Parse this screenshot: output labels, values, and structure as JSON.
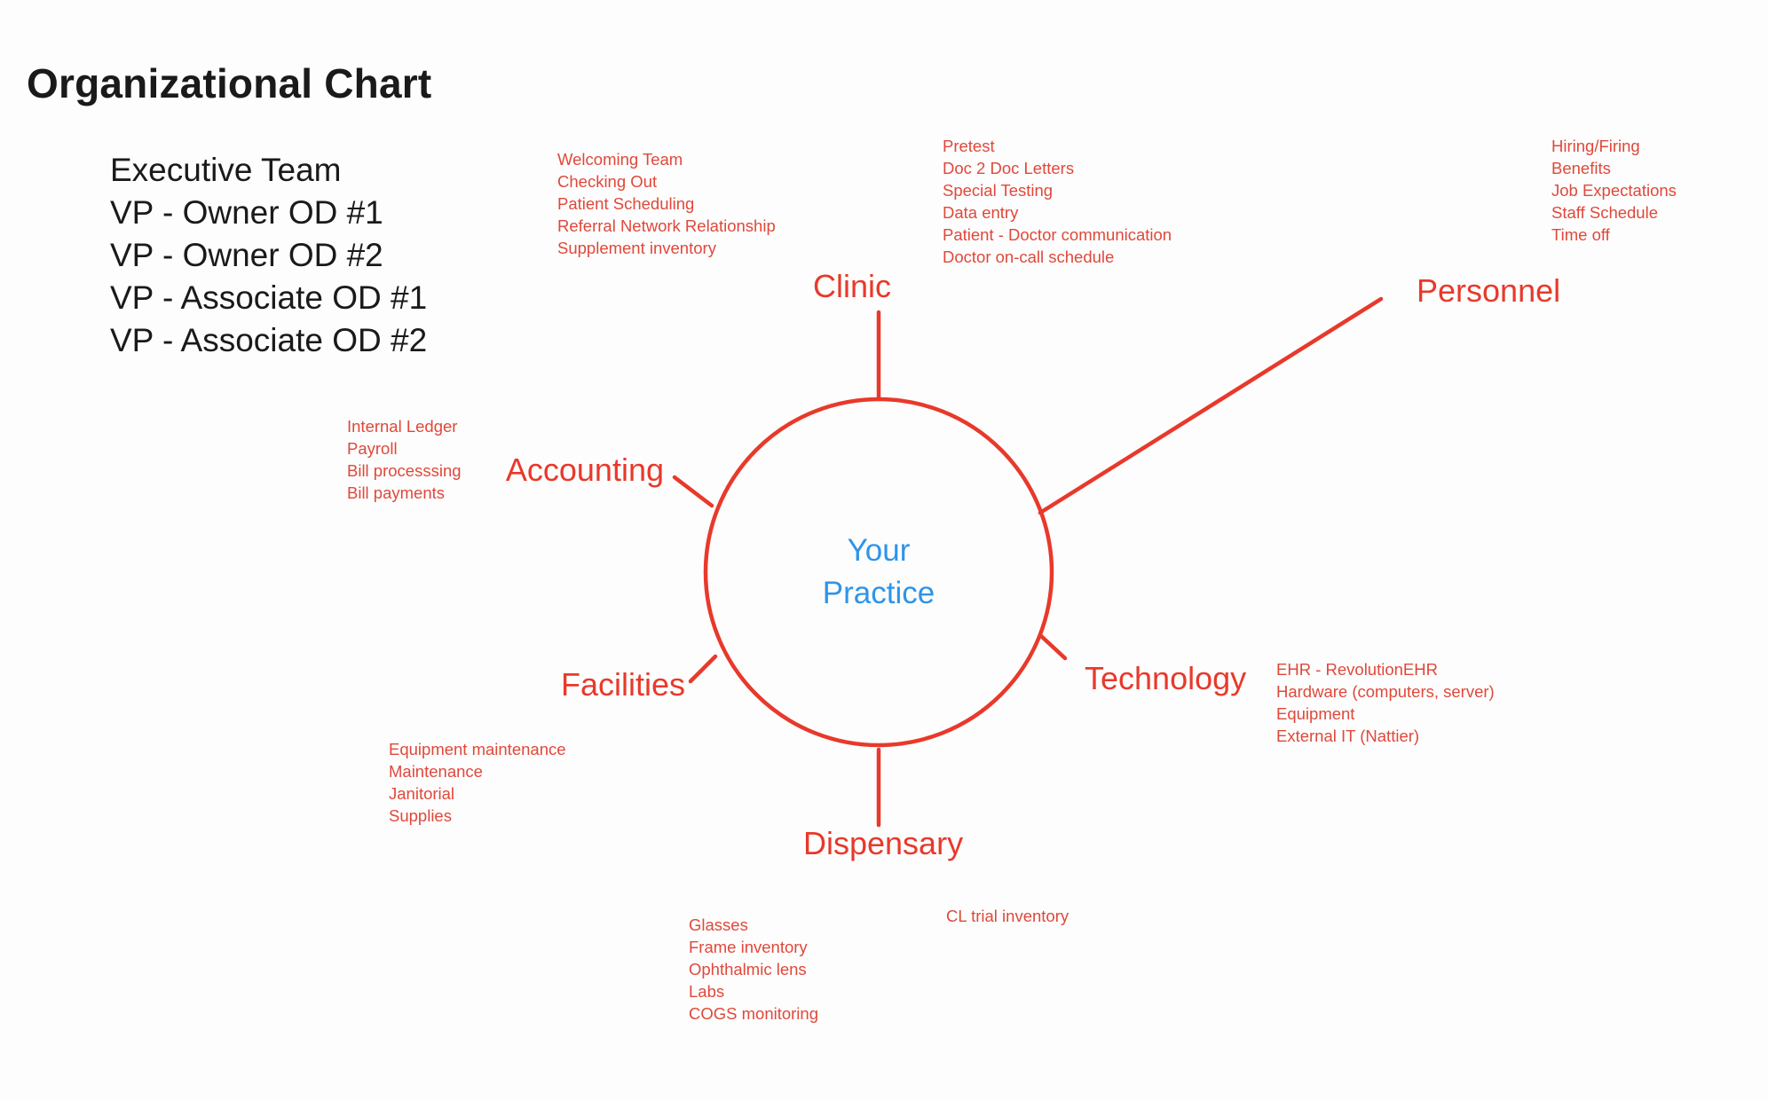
{
  "page": {
    "title": "Organizational Chart",
    "background_color": "#fdfdfd",
    "accent_red": "#e8392b",
    "detail_red": "#e0483a",
    "center_blue": "#2f94e8",
    "text_black": "#1a1a1a"
  },
  "executive_team": {
    "heading": "Executive Team",
    "members": [
      "VP - Owner OD #1",
      "VP - Owner OD #2",
      "VP - Associate OD #1",
      "VP - Associate OD #2"
    ]
  },
  "center": {
    "line1": "Your",
    "line2": "Practice"
  },
  "branches": {
    "clinic": {
      "label": "Clinic",
      "items": [
        "Welcoming Team",
        "Checking Out",
        "Patient Scheduling",
        "Referral Network Relationship",
        "Supplement inventory"
      ]
    },
    "clinic_secondary": {
      "items": [
        "Pretest",
        "Doc 2 Doc Letters",
        "Special Testing",
        "Data entry",
        "Patient - Doctor communication",
        "Doctor on-call schedule"
      ]
    },
    "personnel": {
      "label": "Personnel",
      "items": [
        "Hiring/Firing",
        "Benefits",
        "Job Expectations",
        "Staff Schedule",
        "Time off"
      ]
    },
    "accounting": {
      "label": "Accounting",
      "items": [
        "Internal Ledger",
        "Payroll",
        "Bill processsing",
        "Bill payments"
      ]
    },
    "facilities": {
      "label": "Facilities",
      "items": [
        "Equipment maintenance",
        "Maintenance",
        "Janitorial",
        "Supplies"
      ]
    },
    "technology": {
      "label": "Technology",
      "items": [
        "EHR - RevolutionEHR",
        "Hardware (computers, server)",
        "Equipment",
        "External IT (Nattier)"
      ]
    },
    "dispensary": {
      "label": "Dispensary",
      "items": [
        "Glasses",
        "Frame inventory",
        "Ophthalmic lens",
        "Labs",
        "COGS monitoring"
      ]
    },
    "dispensary_secondary": {
      "items": [
        "CL trial inventory"
      ]
    }
  },
  "chart_data": {
    "type": "diagram",
    "title": "Organizational Chart",
    "layout": "hub-and-spoke",
    "hub": "Your Practice",
    "spokes": [
      {
        "name": "Clinic",
        "angle_deg": 90,
        "children": [
          "Welcoming Team",
          "Checking Out",
          "Patient Scheduling",
          "Referral Network Relationship",
          "Supplement inventory",
          "Pretest",
          "Doc 2 Doc Letters",
          "Special Testing",
          "Data entry",
          "Patient - Doctor communication",
          "Doctor on-call schedule"
        ]
      },
      {
        "name": "Personnel",
        "angle_deg": 32,
        "children": [
          "Hiring/Firing",
          "Benefits",
          "Job Expectations",
          "Staff Schedule",
          "Time off"
        ]
      },
      {
        "name": "Technology",
        "angle_deg": -20,
        "children": [
          "EHR - RevolutionEHR",
          "Hardware (computers, server)",
          "Equipment",
          "External IT (Nattier)"
        ]
      },
      {
        "name": "Dispensary",
        "angle_deg": -90,
        "children": [
          "Glasses",
          "Frame inventory",
          "Ophthalmic lens",
          "Labs",
          "COGS monitoring",
          "CL trial inventory"
        ]
      },
      {
        "name": "Facilities",
        "angle_deg": -160,
        "children": [
          "Equipment maintenance",
          "Maintenance",
          "Janitorial",
          "Supplies"
        ]
      },
      {
        "name": "Accounting",
        "angle_deg": 160,
        "children": [
          "Internal Ledger",
          "Payroll",
          "Bill processsing",
          "Bill payments"
        ]
      }
    ]
  }
}
